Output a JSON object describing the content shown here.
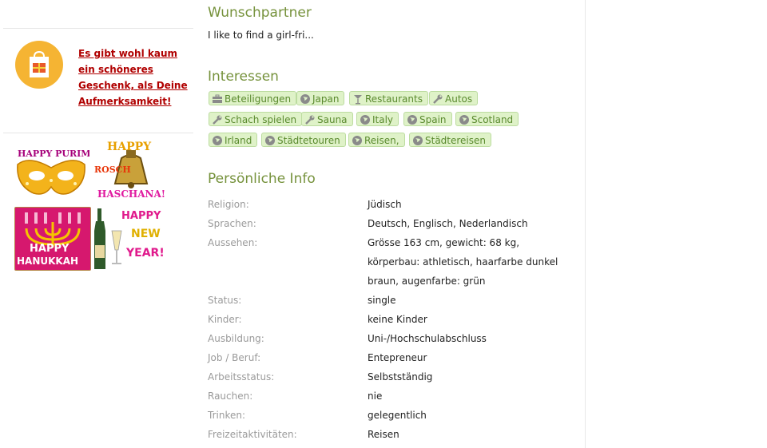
{
  "sidebar": {
    "gift_link": "Es gibt wohl kaum ein schöneres Geschenk, als Deine Aufmerksamkeit!",
    "greetings": [
      {
        "text": "HAPPY PURIM"
      },
      {
        "text": "HAPPY"
      },
      {
        "text": "ROSCH"
      },
      {
        "text": "HASCHANA!"
      },
      {
        "text": "HAPPY"
      },
      {
        "text": "HANUKKAH"
      },
      {
        "text": "HAPPY"
      },
      {
        "text": "NEW"
      },
      {
        "text": "YEAR!"
      }
    ]
  },
  "wunschpartner": {
    "title": "Wunschpartner",
    "text": "I like to find a girl-fri..."
  },
  "interessen": {
    "title": "Interessen",
    "tags": [
      {
        "label": "Beteiligungen",
        "icon": "briefcase-icon"
      },
      {
        "label": "Japan",
        "icon": "globe-icon"
      },
      {
        "label": "Restaurants",
        "icon": "cocktail-icon"
      },
      {
        "label": "Autos",
        "icon": "wrench-icon"
      },
      {
        "label": "Schach spielen",
        "icon": "wrench-icon"
      },
      {
        "label": "Sauna",
        "icon": "wrench-icon"
      },
      {
        "label": "Italy",
        "icon": "globe-icon"
      },
      {
        "label": "Spain",
        "icon": "globe-icon"
      },
      {
        "label": "Scotland",
        "icon": "globe-icon"
      },
      {
        "label": "Irland",
        "icon": "globe-icon"
      },
      {
        "label": "Städtetouren",
        "icon": "globe-icon"
      },
      {
        "label": "Reisen,",
        "icon": "globe-icon"
      },
      {
        "label": "Städtereisen",
        "icon": "globe-icon"
      }
    ]
  },
  "personal": {
    "title": "Persönliche Info",
    "rows": [
      {
        "label": "Religion:",
        "value": "Jüdisch"
      },
      {
        "label": "Sprachen:",
        "value": "Deutsch, Englisch, Nederlandisch"
      },
      {
        "label": "Aussehen:",
        "value": "Grösse 163 cm, gewicht: 68 kg, körperbau: athletisch, haarfarbe dunkel braun, augenfarbe: grün"
      },
      {
        "label": "Status:",
        "value": "single"
      },
      {
        "label": "Kinder:",
        "value": "keine Kinder"
      },
      {
        "label": "Ausbildung:",
        "value": "Uni-/Hochschulabschluss"
      },
      {
        "label": "Job / Beruf:",
        "value": "Entepreneur"
      },
      {
        "label": "Arbeitsstatus:",
        "value": "Selbstständig"
      },
      {
        "label": "Rauchen:",
        "value": "nie"
      },
      {
        "label": "Trinken:",
        "value": "gelegentlich"
      },
      {
        "label": "Freizeitaktivitäten:",
        "value": "Reisen"
      }
    ]
  }
}
